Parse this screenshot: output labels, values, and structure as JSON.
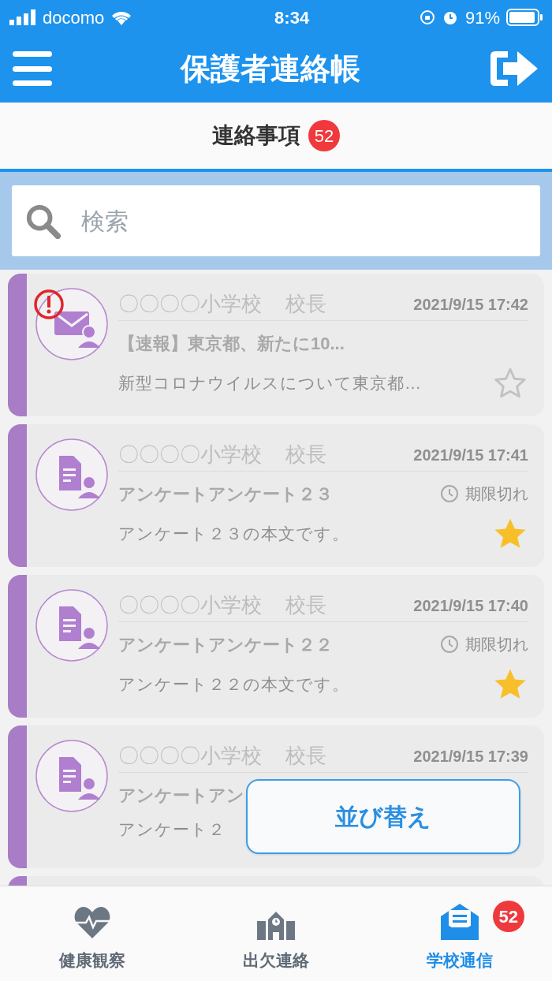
{
  "status_bar": {
    "carrier": "docomo",
    "time": "8:34",
    "battery": "91%"
  },
  "header": {
    "title": "保護者連絡帳"
  },
  "section_tab": {
    "label": "連絡事項",
    "badge": "52"
  },
  "search": {
    "placeholder": "検索"
  },
  "cards": [
    {
      "kind": "mail",
      "urgent": true,
      "sender": "〇〇〇〇小学校",
      "role": "校長",
      "date": "2021/9/15 17:42",
      "title": "【速報】東京都、新たに10...",
      "body": "新型コロナウイルスについて東京都…",
      "starred": false
    },
    {
      "kind": "survey",
      "urgent": false,
      "sender": "〇〇〇〇小学校",
      "role": "校長",
      "date": "2021/9/15 17:41",
      "title": "アンケートアンケート２３",
      "deadline": "期限切れ",
      "body": "アンケート２３の本文です。",
      "starred": true
    },
    {
      "kind": "survey",
      "urgent": false,
      "sender": "〇〇〇〇小学校",
      "role": "校長",
      "date": "2021/9/15 17:40",
      "title": "アンケートアンケート２２",
      "deadline": "期限切れ",
      "body": "アンケート２２の本文です。",
      "starred": true
    },
    {
      "kind": "survey",
      "urgent": false,
      "sender": "〇〇〇〇小学校",
      "role": "校長",
      "date": "2021/9/15 17:39",
      "title": "アンケートアン",
      "body": "アンケート２"
    },
    {
      "kind": "clipped"
    }
  ],
  "sort_button": {
    "label": "並び替え"
  },
  "tab_bar": [
    {
      "kind": "health",
      "label": "健康観察",
      "selected": false
    },
    {
      "kind": "attendance",
      "label": "出欠連絡",
      "selected": false
    },
    {
      "kind": "news",
      "label": "学校通信",
      "selected": true,
      "badge": "52"
    }
  ]
}
